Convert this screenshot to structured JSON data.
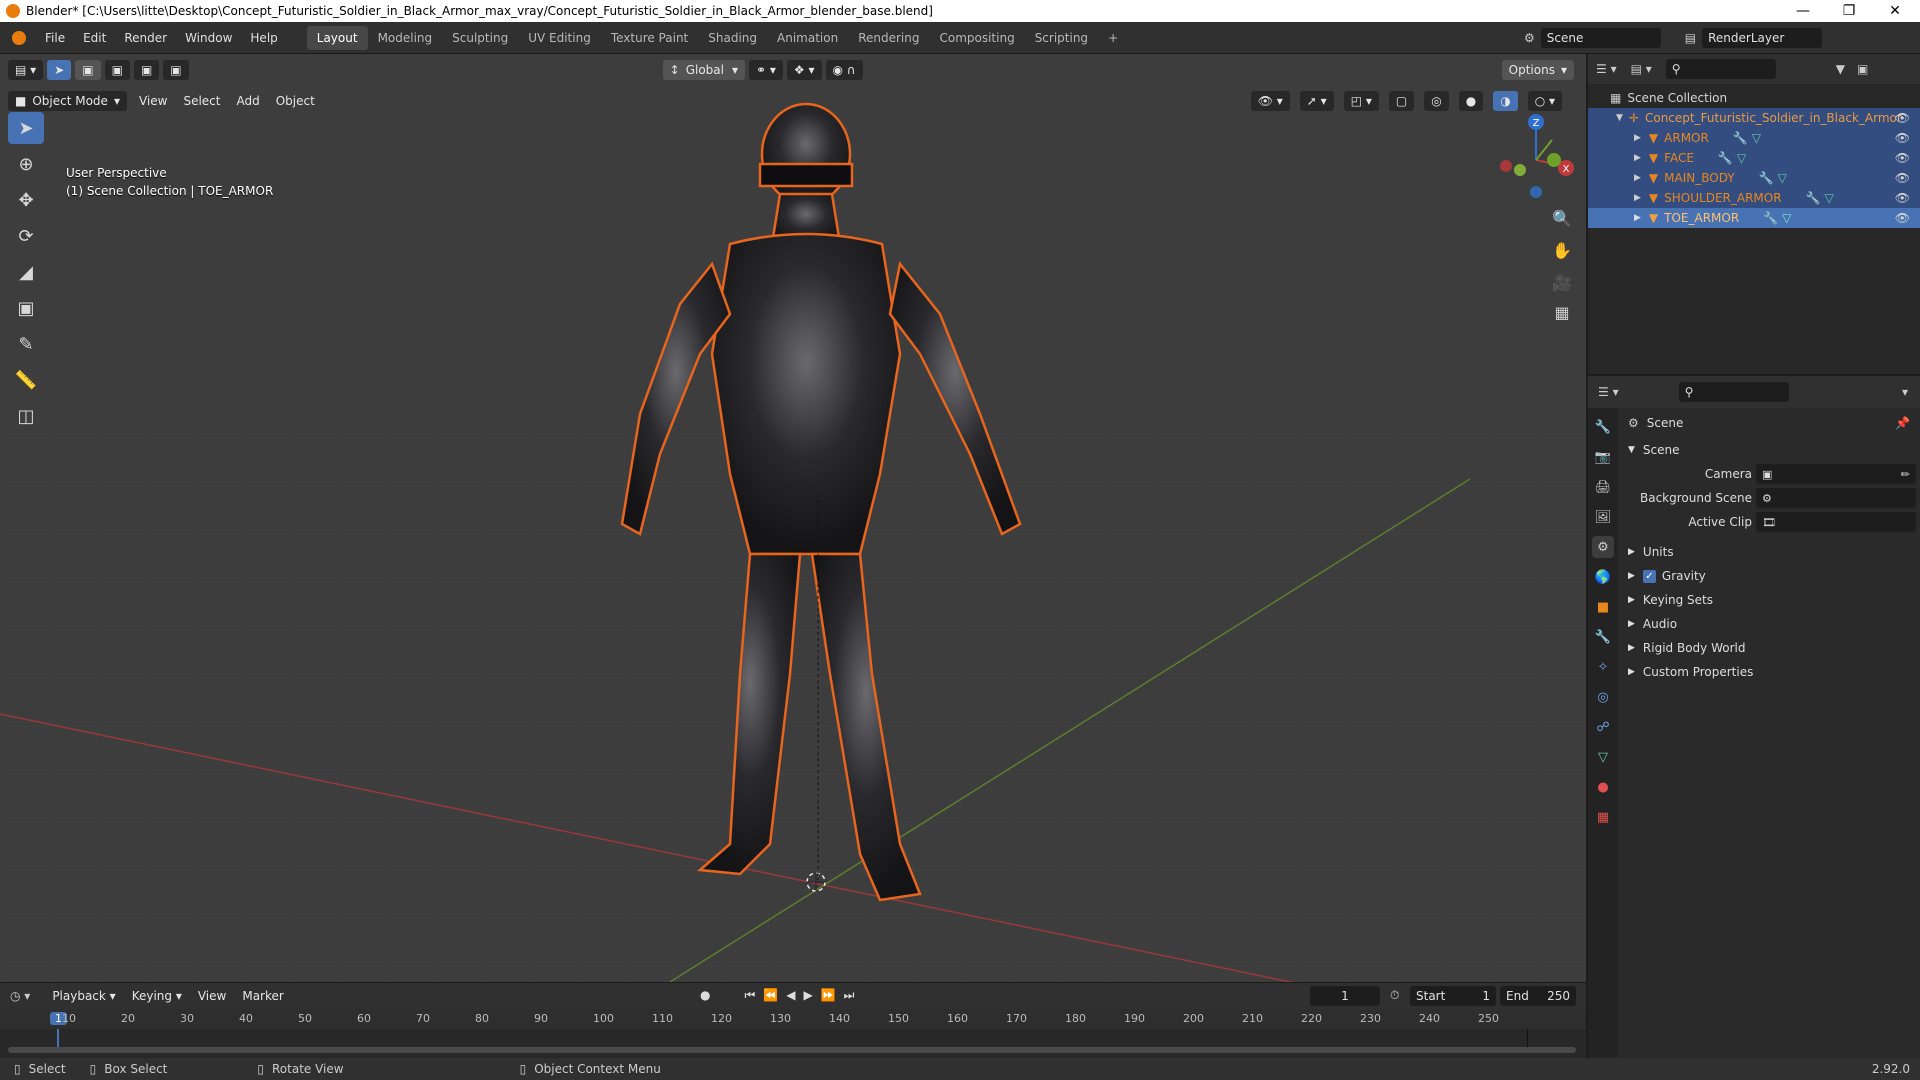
{
  "window": {
    "title": "Blender* [C:\\Users\\litte\\Desktop\\Concept_Futuristic_Soldier_in_Black_Armor_max_vray/Concept_Futuristic_Soldier_in_Black_Armor_blender_base.blend]"
  },
  "menubar": {
    "items": [
      "File",
      "Edit",
      "Render",
      "Window",
      "Help"
    ]
  },
  "workspaces": [
    "Layout",
    "Modeling",
    "Sculpting",
    "UV Editing",
    "Texture Paint",
    "Shading",
    "Animation",
    "Rendering",
    "Compositing",
    "Scripting"
  ],
  "active_workspace": "Layout",
  "scene_field": "Scene",
  "renderlayer_field": "RenderLayer",
  "viewport": {
    "mode": "Object Mode",
    "menus": [
      "View",
      "Select",
      "Add",
      "Object"
    ],
    "orientation": "Global",
    "options": "Options",
    "overlay_line1": "User Perspective",
    "overlay_line2": "(1) Scene Collection | TOE_ARMOR",
    "axis_labels": {
      "x": "X",
      "y": "Y",
      "z": "Z"
    }
  },
  "outliner": {
    "root": "Scene Collection",
    "collection": "Concept_Futuristic_Soldier_in_Black_Armor",
    "objects": [
      "ARMOR",
      "FACE",
      "MAIN_BODY",
      "SHOULDER_ARMOR",
      "TOE_ARMOR"
    ],
    "selected": "TOE_ARMOR"
  },
  "properties": {
    "context": "Scene",
    "panel": "Scene",
    "fields": [
      {
        "label": "Camera",
        "value": ""
      },
      {
        "label": "Background Scene",
        "value": ""
      },
      {
        "label": "Active Clip",
        "value": ""
      }
    ],
    "sections": [
      "Units",
      "Gravity",
      "Keying Sets",
      "Audio",
      "Rigid Body World",
      "Custom Properties"
    ],
    "gravity_checked": true
  },
  "timeline": {
    "menus": [
      "Playback",
      "Keying",
      "View",
      "Marker"
    ],
    "current_frame": "1",
    "start_label": "Start",
    "start": "1",
    "end_label": "End",
    "end": "250",
    "ruler": [
      "1",
      "10",
      "20",
      "30",
      "40",
      "50",
      "60",
      "70",
      "80",
      "90",
      "100",
      "110",
      "120",
      "130",
      "140",
      "150",
      "160",
      "170",
      "180",
      "190",
      "200",
      "210",
      "220",
      "230",
      "240",
      "250"
    ]
  },
  "statusbar": {
    "select": "Select",
    "box_select": "Box Select",
    "rotate": "Rotate View",
    "context_menu": "Object Context Menu",
    "version": "2.92.0"
  },
  "colors": {
    "accent": "#4772b3",
    "selection_outline": "#e8651e",
    "x_axis": "#a43a3a",
    "y_axis": "#5c7d2a"
  }
}
